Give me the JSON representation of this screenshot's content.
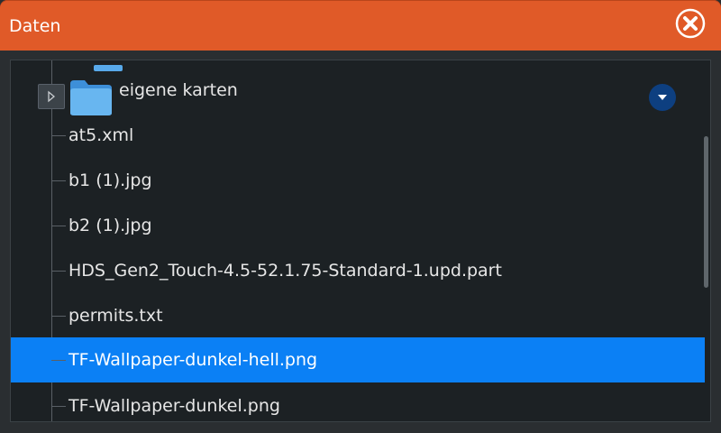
{
  "dialog": {
    "title": "Daten",
    "close_icon": "close-circle-icon"
  },
  "tree": {
    "folder": {
      "label": "eigene karten",
      "icon": "folder-icon",
      "expander_icon": "expand-arrow-icon",
      "menu_icon": "chevron-down-icon"
    },
    "files": [
      {
        "label": "at5.xml",
        "selected": false
      },
      {
        "label": "b1 (1).jpg",
        "selected": false
      },
      {
        "label": "b2 (1).jpg",
        "selected": false
      },
      {
        "label": "HDS_Gen2_Touch-4.5-52.1.75-Standard-1.upd.part",
        "selected": false
      },
      {
        "label": "permits.txt",
        "selected": false
      },
      {
        "label": "TF-Wallpaper-dunkel-hell.png",
        "selected": true
      },
      {
        "label": "TF-Wallpaper-dunkel.png",
        "selected": false
      }
    ]
  },
  "colors": {
    "header": "#e05a28",
    "selection": "#0b80f5",
    "background": "#1c2124",
    "dropdown": "#0d3f80"
  }
}
